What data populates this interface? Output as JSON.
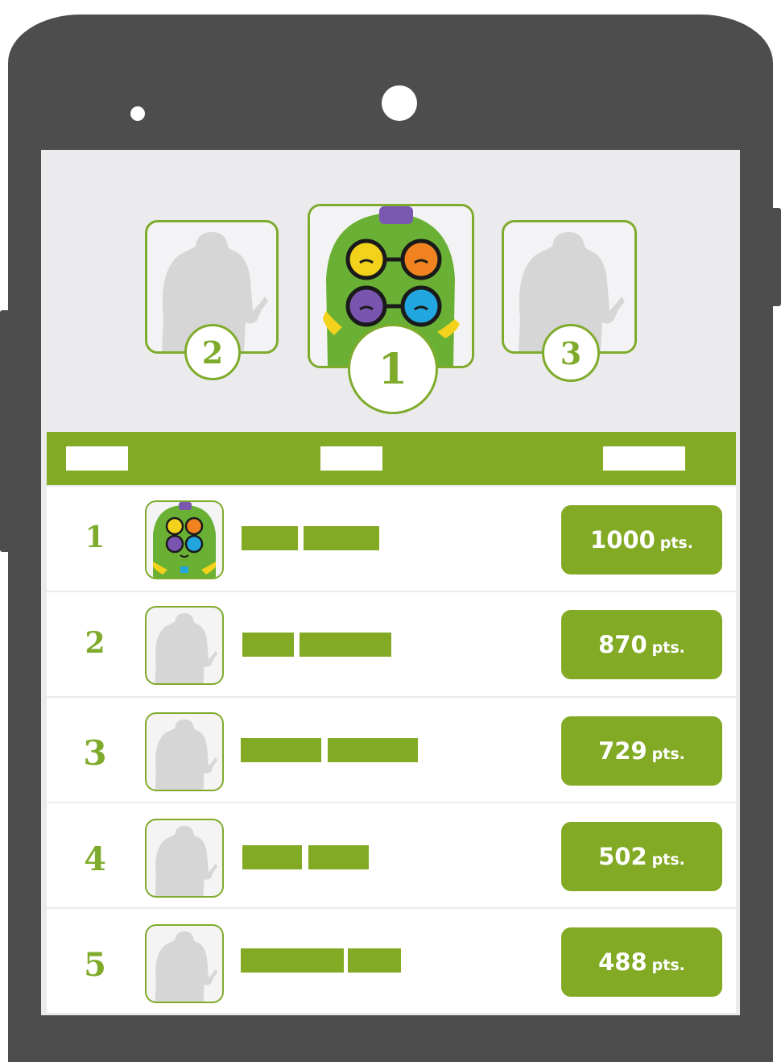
{
  "colors": {
    "accent": "#82aa24",
    "frame": "#4d4d4d",
    "screen_bg": "#ebebee"
  },
  "podium": [
    {
      "place": "1",
      "avatar": "monster-avatar-icon"
    },
    {
      "place": "2",
      "avatar": "silhouette-avatar-icon"
    },
    {
      "place": "3",
      "avatar": "silhouette-avatar-icon"
    }
  ],
  "rows": [
    {
      "rank": "1",
      "avatar": "monster-avatar-icon",
      "points": "1000",
      "unit": "pts."
    },
    {
      "rank": "2",
      "avatar": "silhouette-avatar-icon",
      "points": "870",
      "unit": "pts."
    },
    {
      "rank": "3",
      "avatar": "silhouette-avatar-icon",
      "points": "729",
      "unit": "pts."
    },
    {
      "rank": "4",
      "avatar": "silhouette-avatar-icon",
      "points": "502",
      "unit": "pts."
    },
    {
      "rank": "5",
      "avatar": "silhouette-avatar-icon",
      "points": "488",
      "unit": "pts."
    }
  ]
}
